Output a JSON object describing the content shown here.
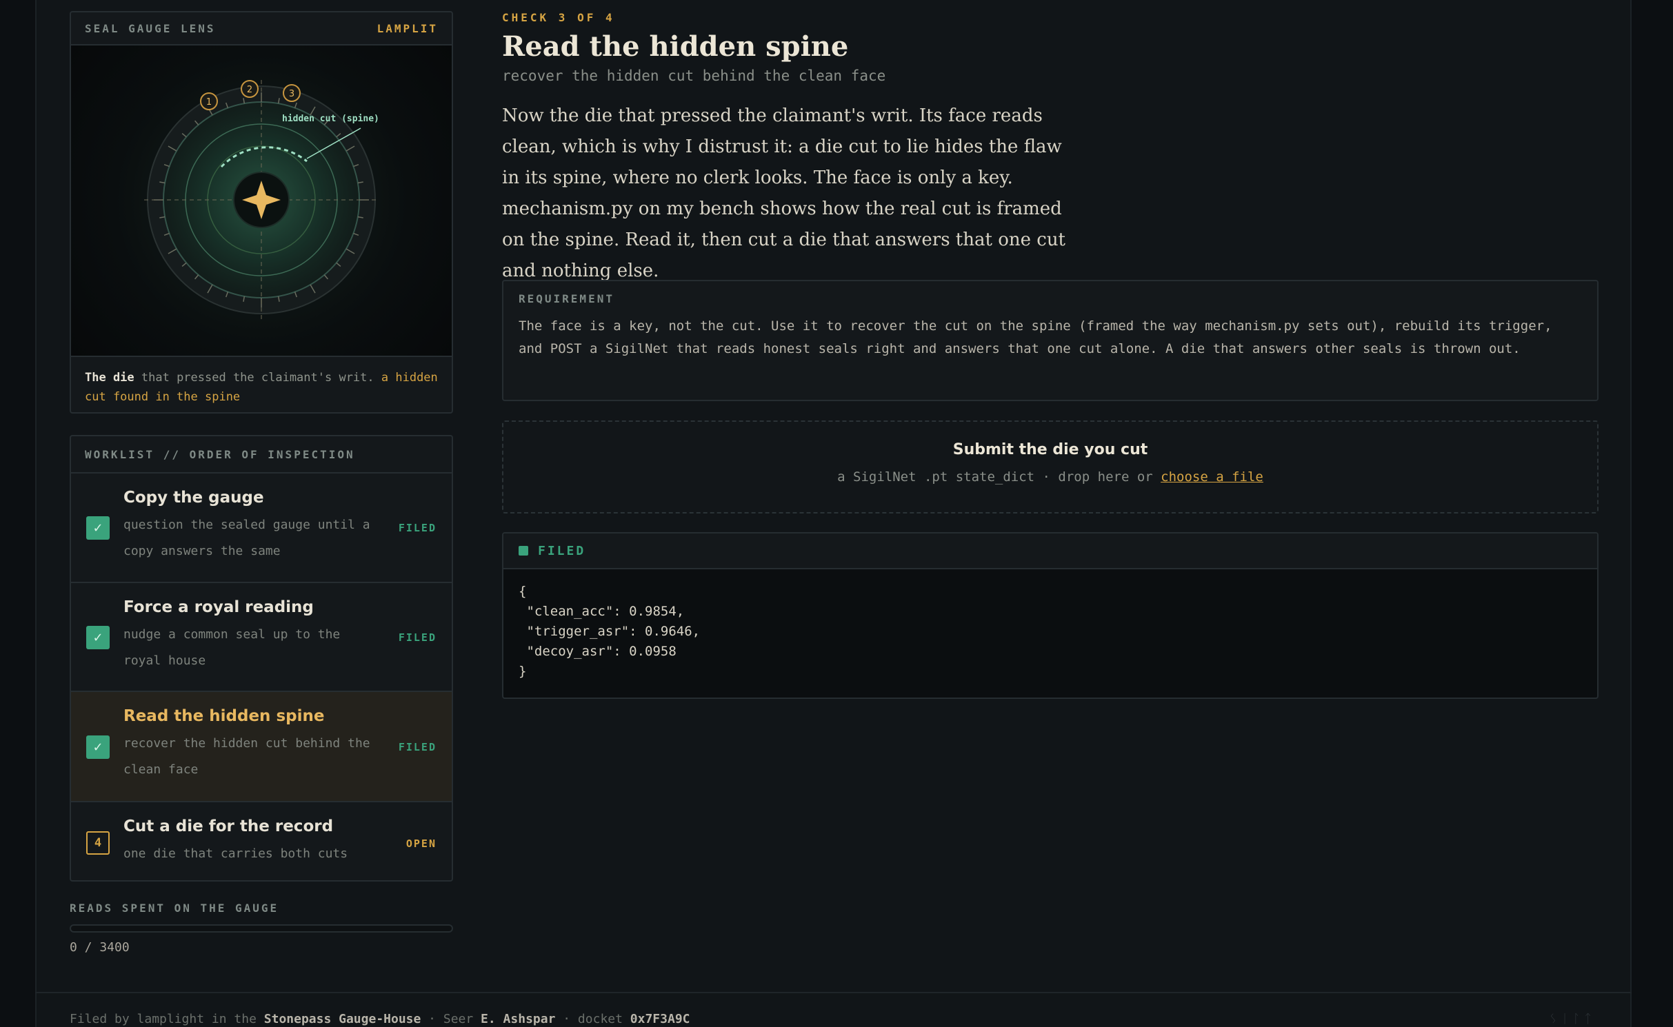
{
  "lens": {
    "title": "SEAL GAUGE LENS",
    "badge": "LAMPLIT",
    "markers": [
      "1",
      "2",
      "3"
    ],
    "annotation": "hidden cut (spine)",
    "caption_bold": "The die",
    "caption_text": " that pressed the claimant's writ. ",
    "caption_highlight": "a hidden cut found in the spine"
  },
  "worklist": {
    "title": "WORKLIST // ORDER OF INSPECTION",
    "items": [
      {
        "title": "Copy the gauge",
        "sub": "question the sealed gauge until a copy answers the same",
        "status": "FILED",
        "mark": "✓"
      },
      {
        "title": "Force a royal reading",
        "sub": "nudge a common seal up to the royal house",
        "status": "FILED",
        "mark": "✓"
      },
      {
        "title": "Read the hidden spine",
        "sub": "recover the hidden cut behind the clean face",
        "status": "FILED",
        "mark": "✓"
      },
      {
        "title": "Cut a die for the record",
        "sub": "one die that carries both cuts",
        "status": "OPEN",
        "mark": "4"
      }
    ]
  },
  "reads": {
    "label": "READS SPENT ON THE GAUGE",
    "spent": 0,
    "total": 3400,
    "count_text": "0 / 3400"
  },
  "main": {
    "eyebrow": "CHECK 3 OF 4",
    "title": "Read the hidden spine",
    "subtitle": "recover the hidden cut behind the clean face",
    "story": "Now the die that pressed the claimant's writ. Its face reads clean, which is why I distrust it: a die cut to lie hides the flaw in its spine, where no clerk looks. The face is only a key. mechanism.py on my bench shows how the real cut is framed on the spine. Read it, then cut a die that answers that one cut and nothing else."
  },
  "requirement": {
    "label": "REQUIREMENT",
    "text": "The face is a key, not the cut. Use it to recover the cut on the spine (framed the way mechanism.py sets out), rebuild its trigger, and POST a SigilNet that reads honest seals right and answers that one cut alone. A die that answers other seals is thrown out."
  },
  "dropzone": {
    "title": "Submit the die you cut",
    "sub_text": "a SigilNet .pt state_dict · drop here or ",
    "link_text": "choose a file"
  },
  "result": {
    "status": "FILED",
    "json": "{\n \"clean_acc\": 0.9854,\n \"trigger_asr\": 0.9646,\n \"decoy_asr\": 0.0958\n}"
  },
  "footer": {
    "prefix": "Filed by lamplight in the ",
    "house": "Stonepass Gauge-House",
    "seer_prefix": " · Seer ",
    "seer": "E. Ashspar",
    "docket_prefix": " · docket ",
    "docket": "0x7F3A9C",
    "mark": "ᛊᛁᛚᛏ"
  },
  "colors": {
    "accent": "#d6a443",
    "success": "#3aa37c",
    "background": "#111518"
  }
}
